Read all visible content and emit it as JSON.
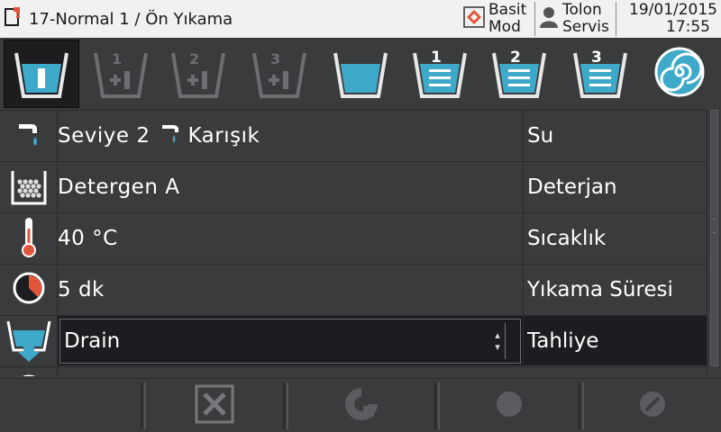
{
  "header": {
    "title": "17-Normal 1 / Ön Yıkama",
    "mode_line1": "Basit",
    "mode_line2": "Mod",
    "user_line1": "Tolon",
    "user_line2": "Servis",
    "date": "19/01/2015",
    "time": "17:55"
  },
  "steps": [
    {
      "name": "prewash",
      "active": true
    },
    {
      "name": "add-1",
      "badge": "1"
    },
    {
      "name": "add-2",
      "badge": "2"
    },
    {
      "name": "add-3",
      "badge": "3"
    },
    {
      "name": "wash"
    },
    {
      "name": "rinse-1",
      "badge": "1"
    },
    {
      "name": "rinse-2",
      "badge": "2"
    },
    {
      "name": "rinse-3",
      "badge": "3"
    },
    {
      "name": "spin"
    }
  ],
  "rows": [
    {
      "value_a": "Seviye  2",
      "value_b": "Karışık",
      "label": "Su"
    },
    {
      "value": "Detergen  A",
      "label": "Deterjan"
    },
    {
      "value": "40  °C",
      "label": "Sıcaklık"
    },
    {
      "value": "5  dk",
      "label": "Yıkama  Süresi"
    },
    {
      "value": "Drain",
      "label": "Tahliye"
    }
  ],
  "colors": {
    "accent": "#3fa9c9",
    "background": "#3a3b3d",
    "header_bg": "#f1f1f1",
    "thermo_red": "#e2553a"
  }
}
